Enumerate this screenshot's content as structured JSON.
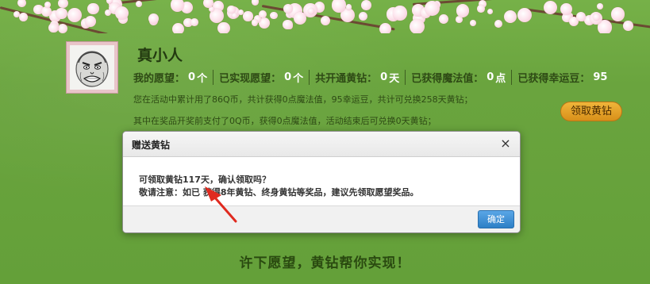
{
  "user": {
    "name": "真小人 "
  },
  "stats": [
    {
      "label": "我的愿望：",
      "value": "0",
      "unit": "个"
    },
    {
      "label": "已实现愿望：",
      "value": "0",
      "unit": "个"
    },
    {
      "label": "共开通黄钻：",
      "value": "0",
      "unit": "天"
    },
    {
      "label": "已获得魔法值：",
      "value": "0",
      "unit": "点"
    },
    {
      "label": "已获得幸运豆：",
      "value": "95",
      "unit": ""
    }
  ],
  "info": {
    "line1": "您在活动中累计用了86Q币，共计获得0点魔法值，95幸运豆，共计可兑换258天黄钻；",
    "line2": "其中在奖品开奖前支付了0Q币，获得0点魔法值，活动结束后可兑换0天黄钻；"
  },
  "claim_button_label": "领取黄钻",
  "footer_slogan": "许下愿望，黄钻帮你实现！",
  "modal": {
    "title": "赠送黄钻",
    "close_glyph": "×",
    "line1": "可领取黄钻117天，确认领取吗？",
    "line2": "敬请注意：如已 获得8年黄钻、终身黄钻等奖品，建议先领取愿望奖品。",
    "confirm_label": "确定"
  },
  "colors": {
    "background": "#6aa53f",
    "accent_orange": "#e8a02a",
    "confirm_blue": "#3d8fd6",
    "annotation_red": "#e02a1f"
  }
}
